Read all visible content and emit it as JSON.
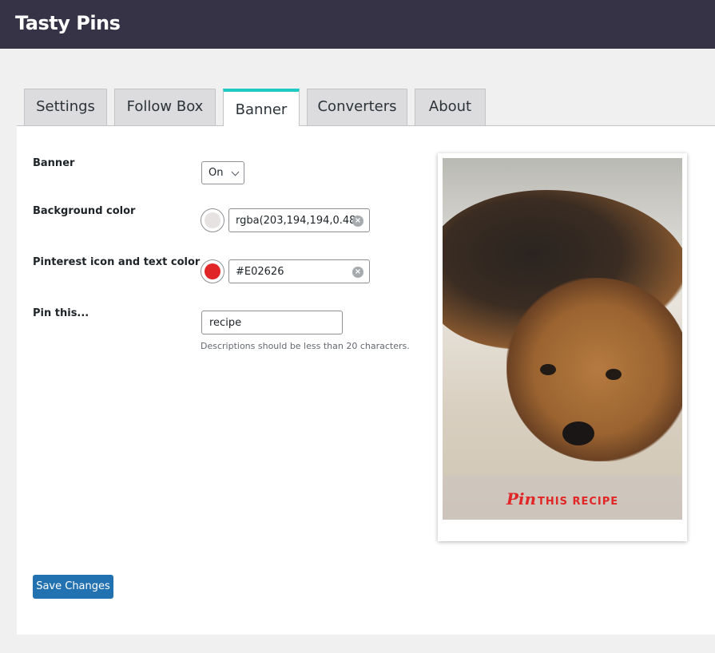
{
  "app": {
    "title": "Tasty Pins"
  },
  "tabs": [
    {
      "label": "Settings"
    },
    {
      "label": "Follow Box"
    },
    {
      "label": "Banner",
      "active": true
    },
    {
      "label": "Converters"
    },
    {
      "label": "About"
    }
  ],
  "form": {
    "banner": {
      "label": "Banner",
      "value": "On"
    },
    "background_color": {
      "label": "Background color",
      "value": "rgba(203,194,194,0.48)",
      "swatch": "#e6e2e2"
    },
    "icon_color": {
      "label": "Pinterest icon and text color",
      "value": "#E02626",
      "swatch": "#e02626"
    },
    "pin_this": {
      "label": "Pin this...",
      "value": "recipe",
      "hint": "Descriptions should be less than 20 characters."
    }
  },
  "preview": {
    "pin_logo": "Pin",
    "banner_text": "THIS RECIPE"
  },
  "colors": {
    "accent": "#1ecbc3",
    "topbar": "#363347",
    "button": "#2271b1"
  },
  "save_label": "Save Changes"
}
